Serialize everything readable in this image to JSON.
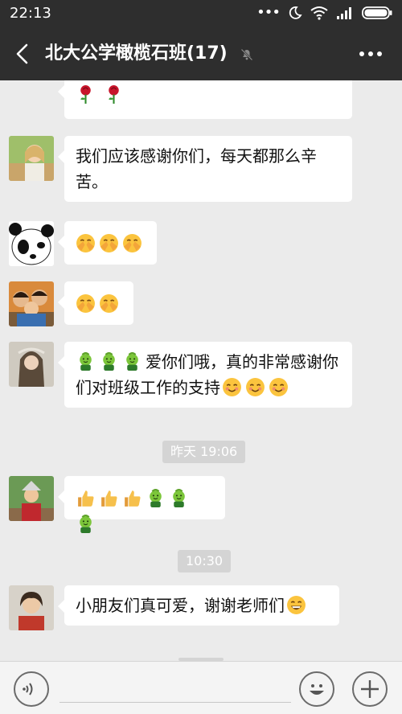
{
  "status_bar": {
    "time": "22:13",
    "icons": [
      "more-dots-icon",
      "moon-icon",
      "wifi-icon",
      "signal-icon",
      "battery-icon"
    ]
  },
  "nav": {
    "title": "北大公学橄榄石班(17)",
    "back_icon": "chevron-left-icon",
    "mute_icon": "bell-off-icon",
    "more_icon": "more-icon"
  },
  "messages": [
    {
      "type": "partial",
      "text": "",
      "emoji": [
        "rose",
        "rose"
      ]
    },
    {
      "type": "text",
      "sender_avatar": "girl-outdoor",
      "text": "我们应该感谢你们，每天都那么辛苦。"
    },
    {
      "type": "emoji",
      "sender_avatar": "panda",
      "emoji": [
        "clap",
        "clap",
        "clap"
      ]
    },
    {
      "type": "emoji",
      "sender_avatar": "family",
      "emoji": [
        "clap",
        "clap"
      ]
    },
    {
      "type": "text",
      "sender_avatar": "woman-hat",
      "prefix_emoji": [
        "sprout",
        "sprout",
        "sprout"
      ],
      "text": "爱你们哦，真的非常感谢你们对班级工作的支持",
      "suffix_emoji": [
        "blush",
        "blush",
        "blush"
      ]
    },
    {
      "type": "time",
      "text": "昨天 19:06"
    },
    {
      "type": "emoji",
      "sender_avatar": "child-costume",
      "emoji": [
        "thumbs-up",
        "thumbs-up",
        "thumbs-up",
        "sprout",
        "sprout",
        "sprout"
      ]
    },
    {
      "type": "time",
      "text": "10:30"
    },
    {
      "type": "text",
      "sender_avatar": "woman-red",
      "text": "小朋友们真可爱，谢谢老师们",
      "suffix_emoji": [
        "grin"
      ]
    }
  ],
  "input_bar": {
    "voice_icon": "voice-icon",
    "emoji_icon": "smiley-icon",
    "plus_icon": "plus-icon"
  },
  "colors": {
    "bar": "#2e2e2e",
    "background": "#ebebeb",
    "bubble": "#ffffff",
    "time_chip": "#d4d4d4"
  }
}
